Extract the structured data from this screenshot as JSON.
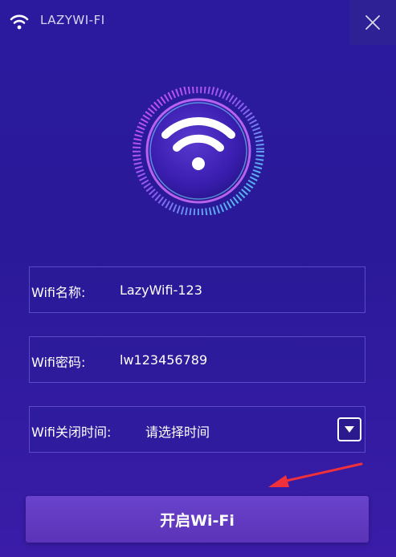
{
  "window": {
    "title": "LAZYWI-FI"
  },
  "form": {
    "ssid": {
      "label": "Wifi名称:",
      "value": "LazyWifi-123"
    },
    "password": {
      "label": "Wifi密码:",
      "value": "lw123456789"
    },
    "close_time": {
      "label": "Wifi关闭时间:",
      "selected": "请选择时间"
    }
  },
  "start_button": {
    "label": "开启Wi-Fi"
  },
  "icons": {
    "app": "wifi-icon",
    "close": "close-icon",
    "logo": "wifi-logo-icon",
    "dropdown": "chevron-down-icon",
    "annotation": "red-arrow-icon"
  },
  "colors": {
    "background": "#2b1a9e",
    "field_border": "#5a49c8",
    "button": "#6a43cc",
    "annotation": "#f0303a"
  }
}
